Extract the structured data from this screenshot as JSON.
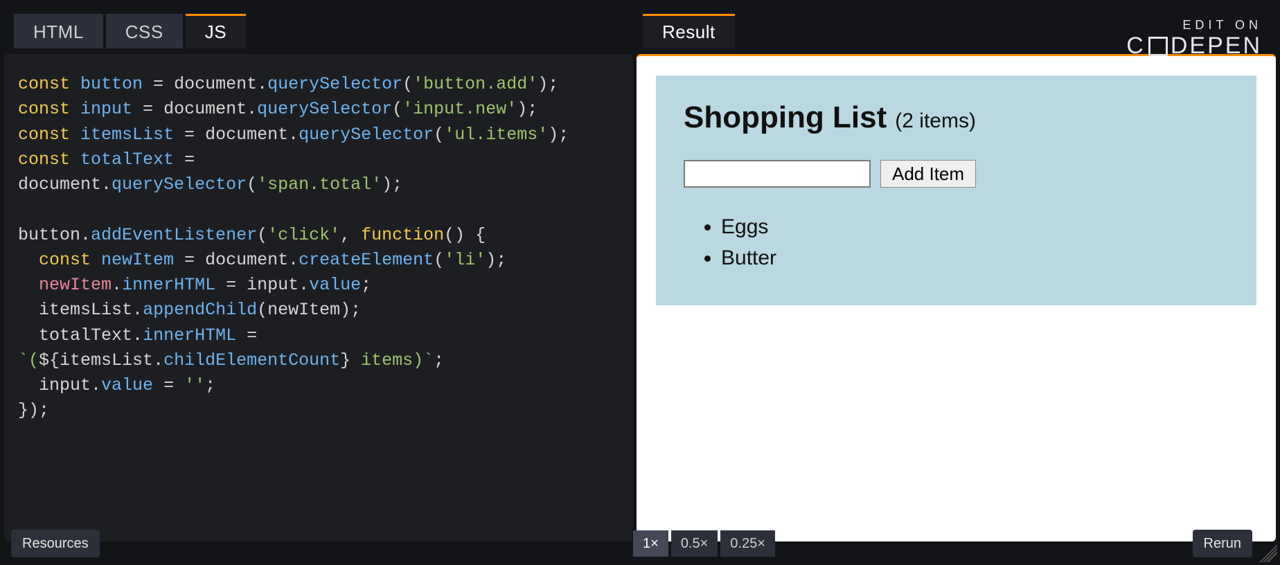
{
  "tabs": {
    "html": "HTML",
    "css": "CSS",
    "js": "JS",
    "result": "Result",
    "active": "JS"
  },
  "brand": {
    "small": "EDIT ON",
    "name_left": "C",
    "name_mid": "DEPEN"
  },
  "code": {
    "lines": [
      [
        [
          "kw",
          "const"
        ],
        [
          "punc",
          " "
        ],
        [
          "var",
          "button"
        ],
        [
          "punc",
          " = "
        ],
        [
          "obj",
          "document"
        ],
        [
          "punc",
          "."
        ],
        [
          "method",
          "querySelector"
        ],
        [
          "punc",
          "("
        ],
        [
          "str",
          "'button.add'"
        ],
        [
          "punc",
          ");"
        ]
      ],
      [
        [
          "kw",
          "const"
        ],
        [
          "punc",
          " "
        ],
        [
          "var",
          "input"
        ],
        [
          "punc",
          " = "
        ],
        [
          "obj",
          "document"
        ],
        [
          "punc",
          "."
        ],
        [
          "method",
          "querySelector"
        ],
        [
          "punc",
          "("
        ],
        [
          "str",
          "'input.new'"
        ],
        [
          "punc",
          ");"
        ]
      ],
      [
        [
          "kw",
          "const"
        ],
        [
          "punc",
          " "
        ],
        [
          "var",
          "itemsList"
        ],
        [
          "punc",
          " = "
        ],
        [
          "obj",
          "document"
        ],
        [
          "punc",
          "."
        ],
        [
          "method",
          "querySelector"
        ],
        [
          "punc",
          "("
        ],
        [
          "str",
          "'ul.items'"
        ],
        [
          "punc",
          ");"
        ]
      ],
      [
        [
          "kw",
          "const"
        ],
        [
          "punc",
          " "
        ],
        [
          "var",
          "totalText"
        ],
        [
          "punc",
          " ="
        ]
      ],
      [
        [
          "obj",
          "document"
        ],
        [
          "punc",
          "."
        ],
        [
          "method",
          "querySelector"
        ],
        [
          "punc",
          "("
        ],
        [
          "str",
          "'span.total'"
        ],
        [
          "punc",
          ");"
        ]
      ],
      [],
      [
        [
          "obj",
          "button"
        ],
        [
          "punc",
          "."
        ],
        [
          "method",
          "addEventListener"
        ],
        [
          "punc",
          "("
        ],
        [
          "str",
          "'click'"
        ],
        [
          "punc",
          ", "
        ],
        [
          "kw",
          "function"
        ],
        [
          "punc",
          "() {"
        ]
      ],
      [
        [
          "punc",
          "  "
        ],
        [
          "kw",
          "const"
        ],
        [
          "punc",
          " "
        ],
        [
          "var",
          "newItem"
        ],
        [
          "punc",
          " = "
        ],
        [
          "obj",
          "document"
        ],
        [
          "punc",
          "."
        ],
        [
          "method",
          "createElement"
        ],
        [
          "punc",
          "("
        ],
        [
          "str",
          "'li'"
        ],
        [
          "punc",
          ");"
        ]
      ],
      [
        [
          "punc",
          "  "
        ],
        [
          "new",
          "newItem"
        ],
        [
          "punc",
          "."
        ],
        [
          "prop",
          "innerHTML"
        ],
        [
          "punc",
          " = "
        ],
        [
          "obj",
          "input"
        ],
        [
          "punc",
          "."
        ],
        [
          "prop",
          "value"
        ],
        [
          "punc",
          ";"
        ]
      ],
      [
        [
          "punc",
          "  "
        ],
        [
          "obj",
          "itemsList"
        ],
        [
          "punc",
          "."
        ],
        [
          "method",
          "appendChild"
        ],
        [
          "punc",
          "("
        ],
        [
          "obj",
          "newItem"
        ],
        [
          "punc",
          ");"
        ]
      ],
      [
        [
          "punc",
          "  "
        ],
        [
          "obj",
          "totalText"
        ],
        [
          "punc",
          "."
        ],
        [
          "prop",
          "innerHTML"
        ],
        [
          "punc",
          " ="
        ]
      ],
      [
        [
          "tmpl",
          "`("
        ],
        [
          "punc",
          "${"
        ],
        [
          "obj",
          "itemsList"
        ],
        [
          "punc",
          "."
        ],
        [
          "prop",
          "childElementCount"
        ],
        [
          "punc",
          "}"
        ],
        [
          "tmpl",
          " items)`"
        ],
        [
          "punc",
          ";"
        ]
      ],
      [
        [
          "punc",
          "  "
        ],
        [
          "obj",
          "input"
        ],
        [
          "punc",
          "."
        ],
        [
          "prop",
          "value"
        ],
        [
          "punc",
          " = "
        ],
        [
          "str",
          "''"
        ],
        [
          "punc",
          ";"
        ]
      ],
      [
        [
          "punc",
          "});"
        ]
      ]
    ]
  },
  "result": {
    "title": "Shopping List",
    "count_text": "(2 items)",
    "input_value": "",
    "add_button": "Add Item",
    "items": [
      "Eggs",
      "Butter"
    ]
  },
  "bottom": {
    "resources": "Resources",
    "zoom": [
      "1×",
      "0.5×",
      "0.25×"
    ],
    "zoom_active": "1×",
    "rerun": "Rerun"
  }
}
